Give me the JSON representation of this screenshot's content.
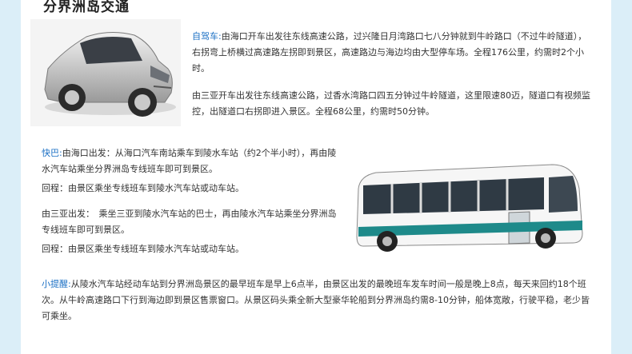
{
  "section_title": "分界洲岛交通",
  "drive": {
    "label": "自驾车:",
    "p1": "由海口开车出发往东线高速公路，过兴隆日月湾路口七八分钟就到牛岭路口（不过牛岭隧道），右拐弯上桥横过高速路左拐即到景区，高速路边与海边均由大型停车场。全程176公里，约需时2个小时。",
    "p2": "由三亚开车出发往东线高速公路，过香水湾路口四五分钟过牛岭隧道，这里限速80迈，隧道口有视频监控，出隧道口右拐即进入景区。全程68公里，约需时50分钟。"
  },
  "bus": {
    "label": "快巴:",
    "haikou": "由海口出发：从海口汽车南站乘车到陵水车站（约2个半小时），再由陵水汽车站乘坐分界洲岛专线班车即可到景区。",
    "haikou_return": "回程：由景区乘坐专线班车到陵水汽车站或动车站。",
    "sanya": "由三亚出发：　乘坐三亚到陵水汽车站的巴士，再由陵水汽车站乘坐分界洲岛专线班车即可到景区。",
    "sanya_return": "回程：由景区乘坐专线班车到陵水汽车站或动车站。"
  },
  "tip": {
    "label": "小提醒:",
    "text": "从陵水汽车站经动车站到分界洲岛景区的最早班车是早上6点半，由景区出发的最晚班车发车时间一般是晚上8点，每天来回约18个班次。从牛岭高速路口下行到海边即到景区售票窗口。从景区码头乘全新大型豪华轮船到分界洲岛约需8-10分钟，船体宽敞，行驶平稳，老少皆可乘坐。"
  },
  "images": {
    "car": "silver-hatchback-car",
    "bus": "white-teal-city-bus"
  },
  "colors": {
    "accent": "#1a6fc4",
    "page_bg": "#dbeef8",
    "bus_stripe": "#1e8a8a"
  }
}
